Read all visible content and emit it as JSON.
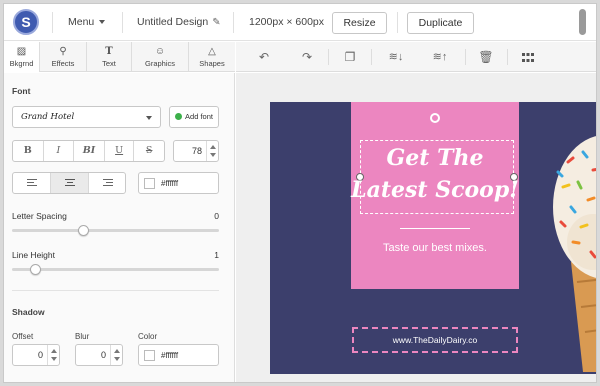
{
  "app": {
    "logo_letter": "S",
    "menu_label": "Menu",
    "design_title": "Untitled Design",
    "canvas_size": "1200px × 600px",
    "resize_label": "Resize",
    "duplicate_label": "Duplicate"
  },
  "tabs": [
    {
      "label": "Bkgrnd",
      "icon": "image-icon"
    },
    {
      "label": "Effects",
      "icon": "magic-wand-icon"
    },
    {
      "label": "Text",
      "icon": "text-icon"
    },
    {
      "label": "Graphics",
      "icon": "smiley-icon"
    },
    {
      "label": "Shapes",
      "icon": "triangle-icon"
    }
  ],
  "font_panel": {
    "section_title": "Font",
    "font_name": "Grand Hotel",
    "add_font_label": "Add font",
    "style_buttons": [
      "B",
      "I",
      "BI",
      "U",
      "S"
    ],
    "font_size": "78",
    "align_buttons": [
      "align-left-icon",
      "align-center-icon",
      "align-right-icon"
    ],
    "text_color": "#ffffff",
    "letter_spacing_label": "Letter Spacing",
    "letter_spacing_value": "0",
    "line_height_label": "Line Height",
    "line_height_value": "1"
  },
  "shadow_panel": {
    "section_title": "Shadow",
    "offset_label": "Offset",
    "offset_value": "0",
    "blur_label": "Blur",
    "blur_value": "0",
    "color_label": "Color",
    "color_value": "#ffffff"
  },
  "canvas_toolbar": [
    "undo-icon",
    "redo-icon",
    "duplicate-icon",
    "layer-down-icon",
    "layer-up-icon",
    "trash-icon",
    "grid-icon"
  ],
  "design": {
    "headline_line1": "Get The",
    "headline_line2": "Latest Scoop!",
    "tagline": "Taste our best mixes.",
    "url": "www.TheDailyDairy.co",
    "background_color": "#3c3f6c",
    "card_color": "#ec86c0"
  }
}
